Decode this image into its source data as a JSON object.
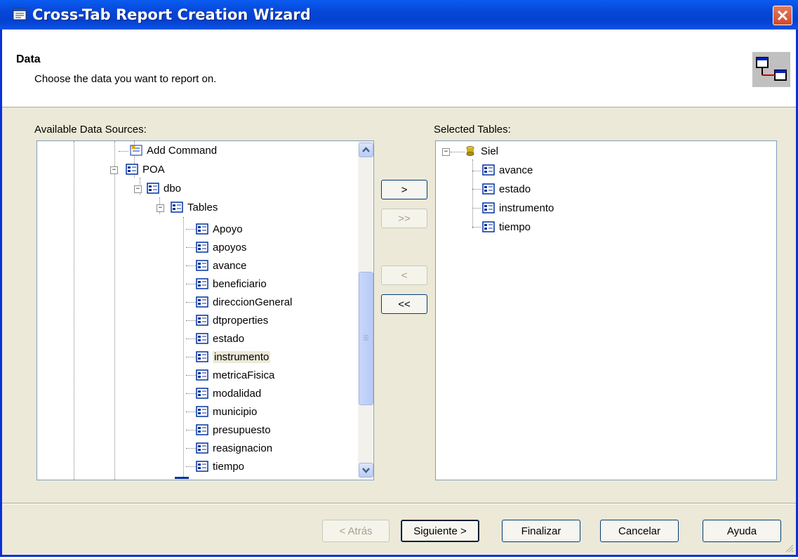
{
  "window": {
    "title": "Cross-Tab Report Creation Wizard"
  },
  "header": {
    "title": "Data",
    "subtitle": "Choose the data you want to report on."
  },
  "available": {
    "label": "Available Data Sources:",
    "items": {
      "add_command": "Add Command",
      "poa": "POA",
      "dbo": "dbo",
      "tables": "Tables",
      "tables_list": [
        "Apoyo",
        "apoyos",
        "avance",
        "beneficiario",
        "direccionGeneral",
        "dtproperties",
        "estado",
        "instrumento",
        "metricaFisica",
        "modalidad",
        "municipio",
        "presupuesto",
        "reasignacion",
        "tiempo"
      ]
    }
  },
  "selected": {
    "label": "Selected Tables:",
    "root": "Siel",
    "items": [
      "avance",
      "estado",
      "instrumento",
      "tiempo"
    ]
  },
  "transfer": {
    "add": ">",
    "add_all": ">>",
    "remove": "<",
    "remove_all": "<<"
  },
  "footer": {
    "back": "< Atrás",
    "next": "Siguiente >",
    "finish": "Finalizar",
    "cancel": "Cancelar",
    "help": "Ayuda"
  }
}
